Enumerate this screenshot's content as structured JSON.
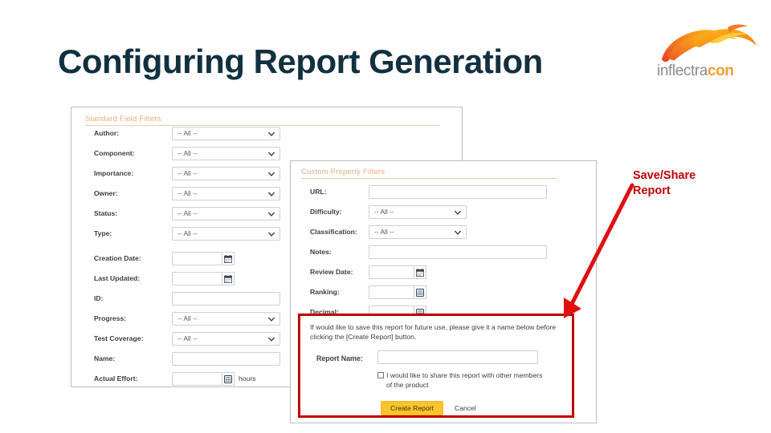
{
  "slide": {
    "title": "Configuring Report Generation",
    "logo": {
      "icon": "phoenix-flame-icon",
      "word_in": "inflectra",
      "word_con": "con"
    },
    "annotation": {
      "label": "Save/Share\nReport",
      "line1": "Save/Share",
      "line2": "Report",
      "color": "#c00000",
      "arrow": "arrow-down-left-icon"
    }
  },
  "standard_filters": {
    "heading": "Standard Field Filters",
    "fields": [
      {
        "label": "Author:",
        "type": "select",
        "value": "-- All --"
      },
      {
        "label": "Component:",
        "type": "select",
        "value": "-- All --"
      },
      {
        "label": "Importance:",
        "type": "select",
        "value": "-- All --"
      },
      {
        "label": "Owner:",
        "type": "select",
        "value": "-- All --"
      },
      {
        "label": "Status:",
        "type": "select",
        "value": "-- All --"
      },
      {
        "label": "Type:",
        "type": "select",
        "value": "-- All --"
      },
      {
        "label": "Creation Date:",
        "type": "date",
        "value": "",
        "icon": "calendar-icon"
      },
      {
        "label": "Last Updated:",
        "type": "date",
        "value": "",
        "icon": "calendar-icon"
      },
      {
        "label": "ID:",
        "type": "text",
        "value": ""
      },
      {
        "label": "Progress:",
        "type": "select",
        "value": "-- All --"
      },
      {
        "label": "Test Coverage:",
        "type": "select",
        "value": "-- All --"
      },
      {
        "label": "Name:",
        "type": "text",
        "value": ""
      },
      {
        "label": "Actual Effort:",
        "type": "number",
        "value": "",
        "icon": "calculator-icon",
        "unit": "hours"
      }
    ]
  },
  "custom_filters": {
    "heading": "Custom Property Filters",
    "fields": [
      {
        "label": "URL:",
        "type": "text",
        "value": ""
      },
      {
        "label": "Difficulty:",
        "type": "select",
        "value": "-- All --"
      },
      {
        "label": "Classification:",
        "type": "select",
        "value": "-- All --"
      },
      {
        "label": "Notes:",
        "type": "text",
        "value": ""
      },
      {
        "label": "Review Date:",
        "type": "date",
        "value": "",
        "icon": "calendar-icon"
      },
      {
        "label": "Ranking:",
        "type": "number",
        "value": "",
        "icon": "calculator-icon"
      },
      {
        "label": "Decimal:",
        "type": "number",
        "value": "",
        "icon": "calculator-icon"
      }
    ]
  },
  "save_report": {
    "instructions": "If would like to save this report for future use, please give it a name below before clicking the [Create Report] button.",
    "report_name_label": "Report Name:",
    "report_name_value": "",
    "share_line1": "I would like to share this report with other members",
    "share_line2": "of the product",
    "share_checked": false,
    "create_button": "Create Report",
    "cancel_button": "Cancel",
    "highlight_color": "#c00000",
    "create_button_color": "#fcc52b"
  }
}
